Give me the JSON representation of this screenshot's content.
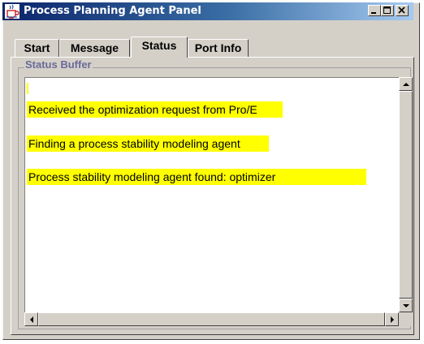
{
  "window": {
    "title": "Process Planning Agent Panel",
    "icon": "java-cup-icon",
    "controls": [
      "minimize-icon",
      "maximize-icon",
      "close-icon"
    ]
  },
  "tabs": [
    {
      "label": "Start",
      "selected": false
    },
    {
      "label": "Message",
      "selected": false
    },
    {
      "label": "Status",
      "selected": true
    },
    {
      "label": "Port Info",
      "selected": false
    }
  ],
  "status_panel": {
    "group_title": "Status Buffer",
    "lines": [
      "Received the optimization request from Pro/E",
      "Finding a process stability modeling agent",
      "Process stability modeling agent found: optimizer"
    ],
    "highlight_color": "#ffff00"
  },
  "colors": {
    "title_bar_start": "#0a246a",
    "title_bar_end": "#a6caf0",
    "window_face": "#d4d0c8",
    "group_title": "#6a6a9a"
  }
}
